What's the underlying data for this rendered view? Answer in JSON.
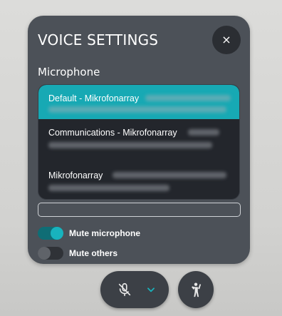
{
  "panel": {
    "title": "VOICE SETTINGS",
    "close_label": "×",
    "section_label": "Microphone"
  },
  "devices": [
    {
      "label": "Default - Mikrofonarray",
      "selected": true
    },
    {
      "label": "Communications - Mikrofonarray",
      "selected": false
    },
    {
      "label": "Mikrofonarray",
      "selected": false
    }
  ],
  "toggles": {
    "mute_microphone": {
      "label": "Mute microphone",
      "on": true
    },
    "mute_others": {
      "label": "Mute others",
      "on": false
    }
  },
  "colors": {
    "accent": "#18b3bd",
    "panel_bg": "#4c5158",
    "list_bg": "#23262c"
  },
  "icons": {
    "close": "close-icon",
    "mic_muted": "microphone-muted-icon",
    "chevron": "chevron-down-icon",
    "raise_hand": "raise-hand-icon"
  }
}
